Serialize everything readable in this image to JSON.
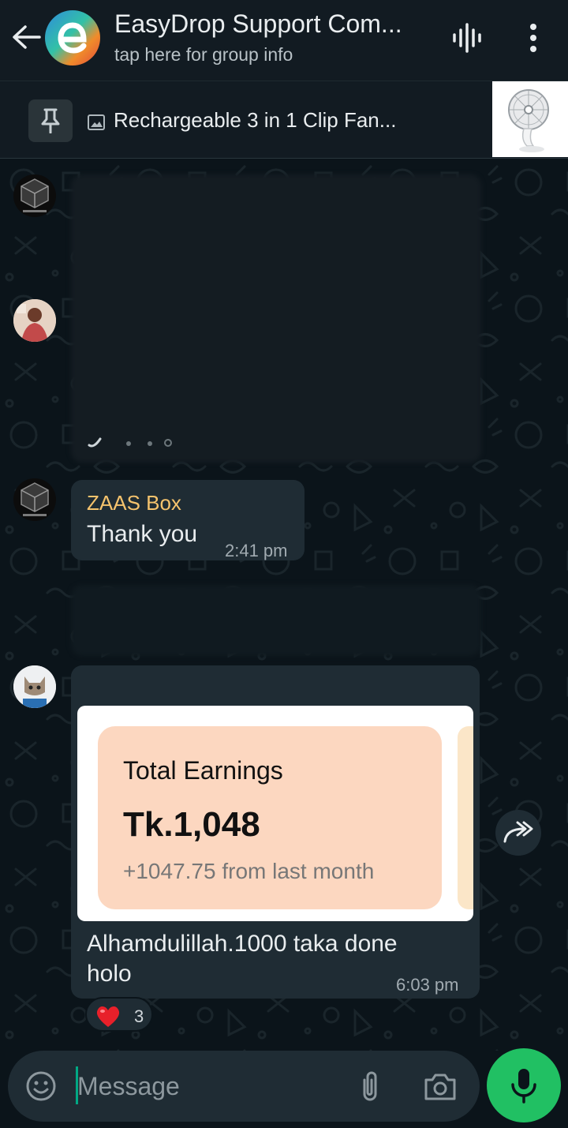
{
  "header": {
    "title": "EasyDrop Support Com...",
    "subtitle": "tap here for group info"
  },
  "pinned": {
    "text": "Rechargeable 3 in 1 Clip Fan..."
  },
  "messages": [
    {
      "sender": "ZAAS Box",
      "text": "Thank you",
      "time": "2:41 pm"
    },
    {
      "image_card": {
        "title": "Total Earnings",
        "amount": "Tk.1,048",
        "change": "+1047.75 from last month"
      },
      "text": "Alhamdulillah.1000 taka done holo",
      "time": "6:03 pm",
      "reaction": {
        "emoji": "heart",
        "count": "3"
      }
    }
  ],
  "composer": {
    "placeholder": "Message"
  },
  "colors": {
    "accent": "#21c063",
    "sender_name": "#f5c36d",
    "bubble": "#1f2c34",
    "background": "#0b141a"
  },
  "icons": [
    "back-icon",
    "voice-call-icon",
    "menu-icon",
    "pin-icon",
    "image-icon",
    "forward-icon",
    "heart-icon",
    "emoji-icon",
    "attach-icon",
    "camera-icon",
    "mic-icon"
  ]
}
